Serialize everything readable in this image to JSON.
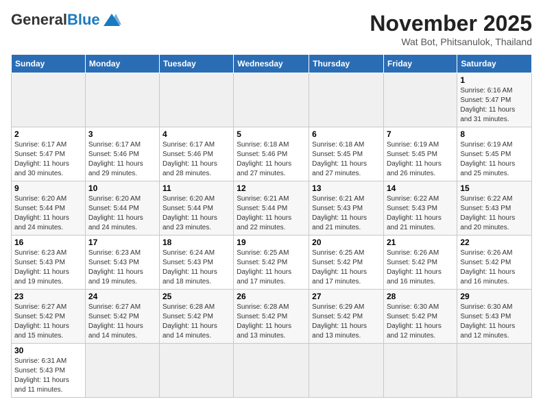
{
  "header": {
    "logo_general": "General",
    "logo_blue": "Blue",
    "month_title": "November 2025",
    "subtitle": "Wat Bot, Phitsanulok, Thailand"
  },
  "weekdays": [
    "Sunday",
    "Monday",
    "Tuesday",
    "Wednesday",
    "Thursday",
    "Friday",
    "Saturday"
  ],
  "weeks": [
    [
      {
        "day": "",
        "info": ""
      },
      {
        "day": "",
        "info": ""
      },
      {
        "day": "",
        "info": ""
      },
      {
        "day": "",
        "info": ""
      },
      {
        "day": "",
        "info": ""
      },
      {
        "day": "",
        "info": ""
      },
      {
        "day": "1",
        "info": "Sunrise: 6:16 AM\nSunset: 5:47 PM\nDaylight: 11 hours\nand 31 minutes."
      }
    ],
    [
      {
        "day": "2",
        "info": "Sunrise: 6:17 AM\nSunset: 5:47 PM\nDaylight: 11 hours\nand 30 minutes."
      },
      {
        "day": "3",
        "info": "Sunrise: 6:17 AM\nSunset: 5:46 PM\nDaylight: 11 hours\nand 29 minutes."
      },
      {
        "day": "4",
        "info": "Sunrise: 6:17 AM\nSunset: 5:46 PM\nDaylight: 11 hours\nand 28 minutes."
      },
      {
        "day": "5",
        "info": "Sunrise: 6:18 AM\nSunset: 5:46 PM\nDaylight: 11 hours\nand 27 minutes."
      },
      {
        "day": "6",
        "info": "Sunrise: 6:18 AM\nSunset: 5:45 PM\nDaylight: 11 hours\nand 27 minutes."
      },
      {
        "day": "7",
        "info": "Sunrise: 6:19 AM\nSunset: 5:45 PM\nDaylight: 11 hours\nand 26 minutes."
      },
      {
        "day": "8",
        "info": "Sunrise: 6:19 AM\nSunset: 5:45 PM\nDaylight: 11 hours\nand 25 minutes."
      }
    ],
    [
      {
        "day": "9",
        "info": "Sunrise: 6:20 AM\nSunset: 5:44 PM\nDaylight: 11 hours\nand 24 minutes."
      },
      {
        "day": "10",
        "info": "Sunrise: 6:20 AM\nSunset: 5:44 PM\nDaylight: 11 hours\nand 24 minutes."
      },
      {
        "day": "11",
        "info": "Sunrise: 6:20 AM\nSunset: 5:44 PM\nDaylight: 11 hours\nand 23 minutes."
      },
      {
        "day": "12",
        "info": "Sunrise: 6:21 AM\nSunset: 5:44 PM\nDaylight: 11 hours\nand 22 minutes."
      },
      {
        "day": "13",
        "info": "Sunrise: 6:21 AM\nSunset: 5:43 PM\nDaylight: 11 hours\nand 21 minutes."
      },
      {
        "day": "14",
        "info": "Sunrise: 6:22 AM\nSunset: 5:43 PM\nDaylight: 11 hours\nand 21 minutes."
      },
      {
        "day": "15",
        "info": "Sunrise: 6:22 AM\nSunset: 5:43 PM\nDaylight: 11 hours\nand 20 minutes."
      }
    ],
    [
      {
        "day": "16",
        "info": "Sunrise: 6:23 AM\nSunset: 5:43 PM\nDaylight: 11 hours\nand 19 minutes."
      },
      {
        "day": "17",
        "info": "Sunrise: 6:23 AM\nSunset: 5:43 PM\nDaylight: 11 hours\nand 19 minutes."
      },
      {
        "day": "18",
        "info": "Sunrise: 6:24 AM\nSunset: 5:43 PM\nDaylight: 11 hours\nand 18 minutes."
      },
      {
        "day": "19",
        "info": "Sunrise: 6:25 AM\nSunset: 5:42 PM\nDaylight: 11 hours\nand 17 minutes."
      },
      {
        "day": "20",
        "info": "Sunrise: 6:25 AM\nSunset: 5:42 PM\nDaylight: 11 hours\nand 17 minutes."
      },
      {
        "day": "21",
        "info": "Sunrise: 6:26 AM\nSunset: 5:42 PM\nDaylight: 11 hours\nand 16 minutes."
      },
      {
        "day": "22",
        "info": "Sunrise: 6:26 AM\nSunset: 5:42 PM\nDaylight: 11 hours\nand 16 minutes."
      }
    ],
    [
      {
        "day": "23",
        "info": "Sunrise: 6:27 AM\nSunset: 5:42 PM\nDaylight: 11 hours\nand 15 minutes."
      },
      {
        "day": "24",
        "info": "Sunrise: 6:27 AM\nSunset: 5:42 PM\nDaylight: 11 hours\nand 14 minutes."
      },
      {
        "day": "25",
        "info": "Sunrise: 6:28 AM\nSunset: 5:42 PM\nDaylight: 11 hours\nand 14 minutes."
      },
      {
        "day": "26",
        "info": "Sunrise: 6:28 AM\nSunset: 5:42 PM\nDaylight: 11 hours\nand 13 minutes."
      },
      {
        "day": "27",
        "info": "Sunrise: 6:29 AM\nSunset: 5:42 PM\nDaylight: 11 hours\nand 13 minutes."
      },
      {
        "day": "28",
        "info": "Sunrise: 6:30 AM\nSunset: 5:42 PM\nDaylight: 11 hours\nand 12 minutes."
      },
      {
        "day": "29",
        "info": "Sunrise: 6:30 AM\nSunset: 5:43 PM\nDaylight: 11 hours\nand 12 minutes."
      }
    ],
    [
      {
        "day": "30",
        "info": "Sunrise: 6:31 AM\nSunset: 5:43 PM\nDaylight: 11 hours\nand 11 minutes."
      },
      {
        "day": "",
        "info": ""
      },
      {
        "day": "",
        "info": ""
      },
      {
        "day": "",
        "info": ""
      },
      {
        "day": "",
        "info": ""
      },
      {
        "day": "",
        "info": ""
      },
      {
        "day": "",
        "info": ""
      }
    ]
  ]
}
